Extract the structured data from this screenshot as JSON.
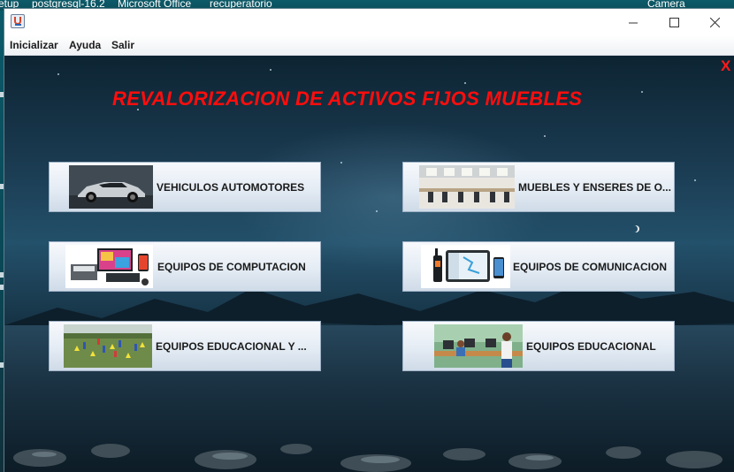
{
  "taskbar": {
    "items": [
      "etup",
      "postgresql-16.2",
      "Microsoft Office",
      "recuperatorio",
      "Camera"
    ]
  },
  "window": {
    "minimize_icon": "minimize-icon",
    "maximize_icon": "maximize-icon",
    "close_icon": "close-icon"
  },
  "menu": {
    "items": [
      "Inicializar",
      "Ayuda",
      "Salir"
    ]
  },
  "main": {
    "close_label": "X",
    "title": "REVALORIZACION DE ACTIVOS FIJOS MUEBLES",
    "buttons": [
      {
        "label": "VEHICULOS AUTOMOTORES",
        "image": "sports-car-image"
      },
      {
        "label": "MUEBLES Y ENSERES DE O...",
        "image": "office-furniture-image"
      },
      {
        "label": "EQUIPOS DE COMPUTACION",
        "image": "computer-equipment-image"
      },
      {
        "label": "EQUIPOS DE COMUNICACION",
        "image": "communication-devices-image"
      },
      {
        "label": "EQUIPOS EDUCACIONAL Y ...",
        "image": "sports-field-image"
      },
      {
        "label": "EQUIPOS EDUCACIONAL",
        "image": "classroom-students-image"
      }
    ]
  },
  "colors": {
    "title": "#ff0d0d",
    "close_x": "#ff1a1a",
    "button_gradient_top": "#f7f9fc",
    "button_gradient_bottom": "#cfdbe8"
  }
}
